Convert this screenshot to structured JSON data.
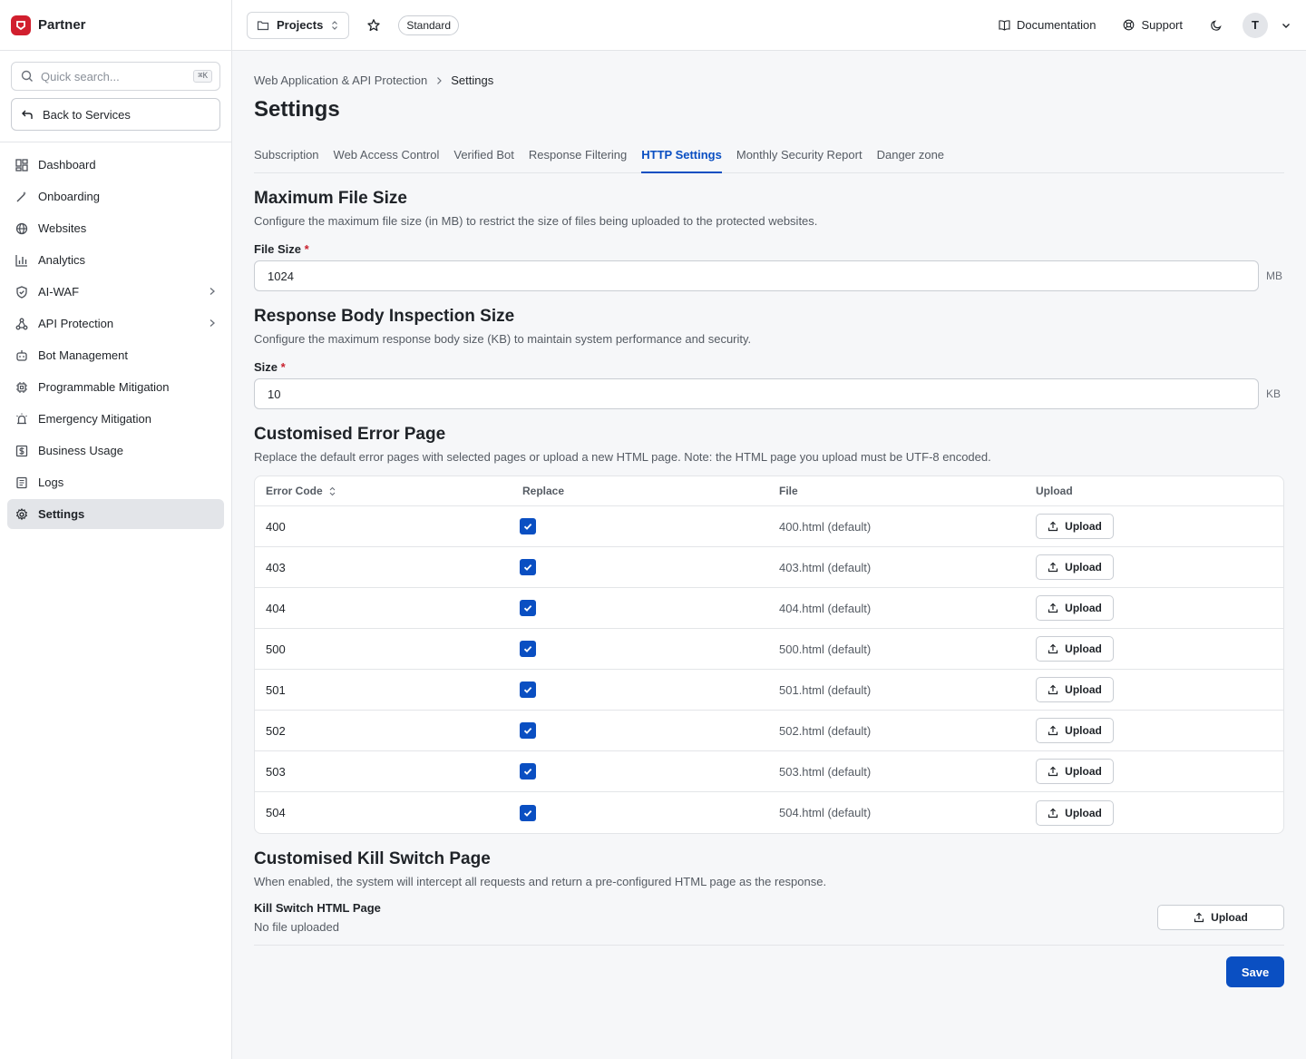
{
  "brand": {
    "name": "Partner"
  },
  "sidebar": {
    "search_placeholder": "Quick search...",
    "search_shortcut": "⌘K",
    "back_label": "Back to Services",
    "items": [
      {
        "label": "Dashboard",
        "icon": "dashboard-icon"
      },
      {
        "label": "Onboarding",
        "icon": "wand-icon"
      },
      {
        "label": "Websites",
        "icon": "globe-icon"
      },
      {
        "label": "Analytics",
        "icon": "bar-chart-icon"
      },
      {
        "label": "AI-WAF",
        "icon": "shield-icon"
      },
      {
        "label": "API Protection",
        "icon": "webhook-icon"
      },
      {
        "label": "Bot Management",
        "icon": "bot-icon"
      },
      {
        "label": "Programmable Mitigation",
        "icon": "chip-icon"
      },
      {
        "label": "Emergency Mitigation",
        "icon": "siren-icon"
      },
      {
        "label": "Business Usage",
        "icon": "dollar-icon"
      },
      {
        "label": "Logs",
        "icon": "logs-icon"
      },
      {
        "label": "Settings",
        "icon": "gear-icon"
      }
    ]
  },
  "topbar": {
    "project_label": "Projects",
    "plan_badge": "Standard",
    "documentation_label": "Documentation",
    "support_label": "Support",
    "avatar_initial": "T"
  },
  "breadcrumb": {
    "parent": "Web Application & API Protection",
    "current": "Settings"
  },
  "page_title": "Settings",
  "tabs": [
    "Subscription",
    "Web Access Control",
    "Verified Bot",
    "Response Filtering",
    "HTTP Settings",
    "Monthly Security Report",
    "Danger zone"
  ],
  "active_tab": "HTTP Settings",
  "max_file_size": {
    "title": "Maximum File Size",
    "description": "Configure the maximum file size (in MB) to restrict the size of files being uploaded to the protected websites.",
    "label": "File Size",
    "value": "1024",
    "unit": "MB"
  },
  "response_body": {
    "title": "Response Body Inspection Size",
    "description": "Configure the maximum response body size (KB) to maintain system performance and security.",
    "label": "Size",
    "value": "10",
    "unit": "KB"
  },
  "error_page": {
    "title": "Customised Error Page",
    "description": "Replace the default error pages with selected pages or upload a new HTML page. Note: the HTML page you upload must be UTF-8 encoded.",
    "columns": [
      "Error Code",
      "Replace",
      "File",
      "Upload"
    ],
    "upload_label": "Upload",
    "rows": [
      {
        "code": "400",
        "replace": true,
        "file": "400.html (default)"
      },
      {
        "code": "403",
        "replace": true,
        "file": "403.html (default)"
      },
      {
        "code": "404",
        "replace": true,
        "file": "404.html (default)"
      },
      {
        "code": "500",
        "replace": true,
        "file": "500.html (default)"
      },
      {
        "code": "501",
        "replace": true,
        "file": "501.html (default)"
      },
      {
        "code": "502",
        "replace": true,
        "file": "502.html (default)"
      },
      {
        "code": "503",
        "replace": true,
        "file": "503.html (default)"
      },
      {
        "code": "504",
        "replace": true,
        "file": "504.html (default)"
      }
    ]
  },
  "kill_switch": {
    "title": "Customised Kill Switch Page",
    "description": "When enabled, the system will intercept all requests and return a pre-configured HTML page as the response.",
    "label": "Kill Switch HTML Page",
    "status": "No file uploaded",
    "upload_label": "Upload"
  },
  "save_label": "Save",
  "colors": {
    "accent": "#0a4fc2",
    "brand": "#d11f2e",
    "required": "#c9212e"
  }
}
